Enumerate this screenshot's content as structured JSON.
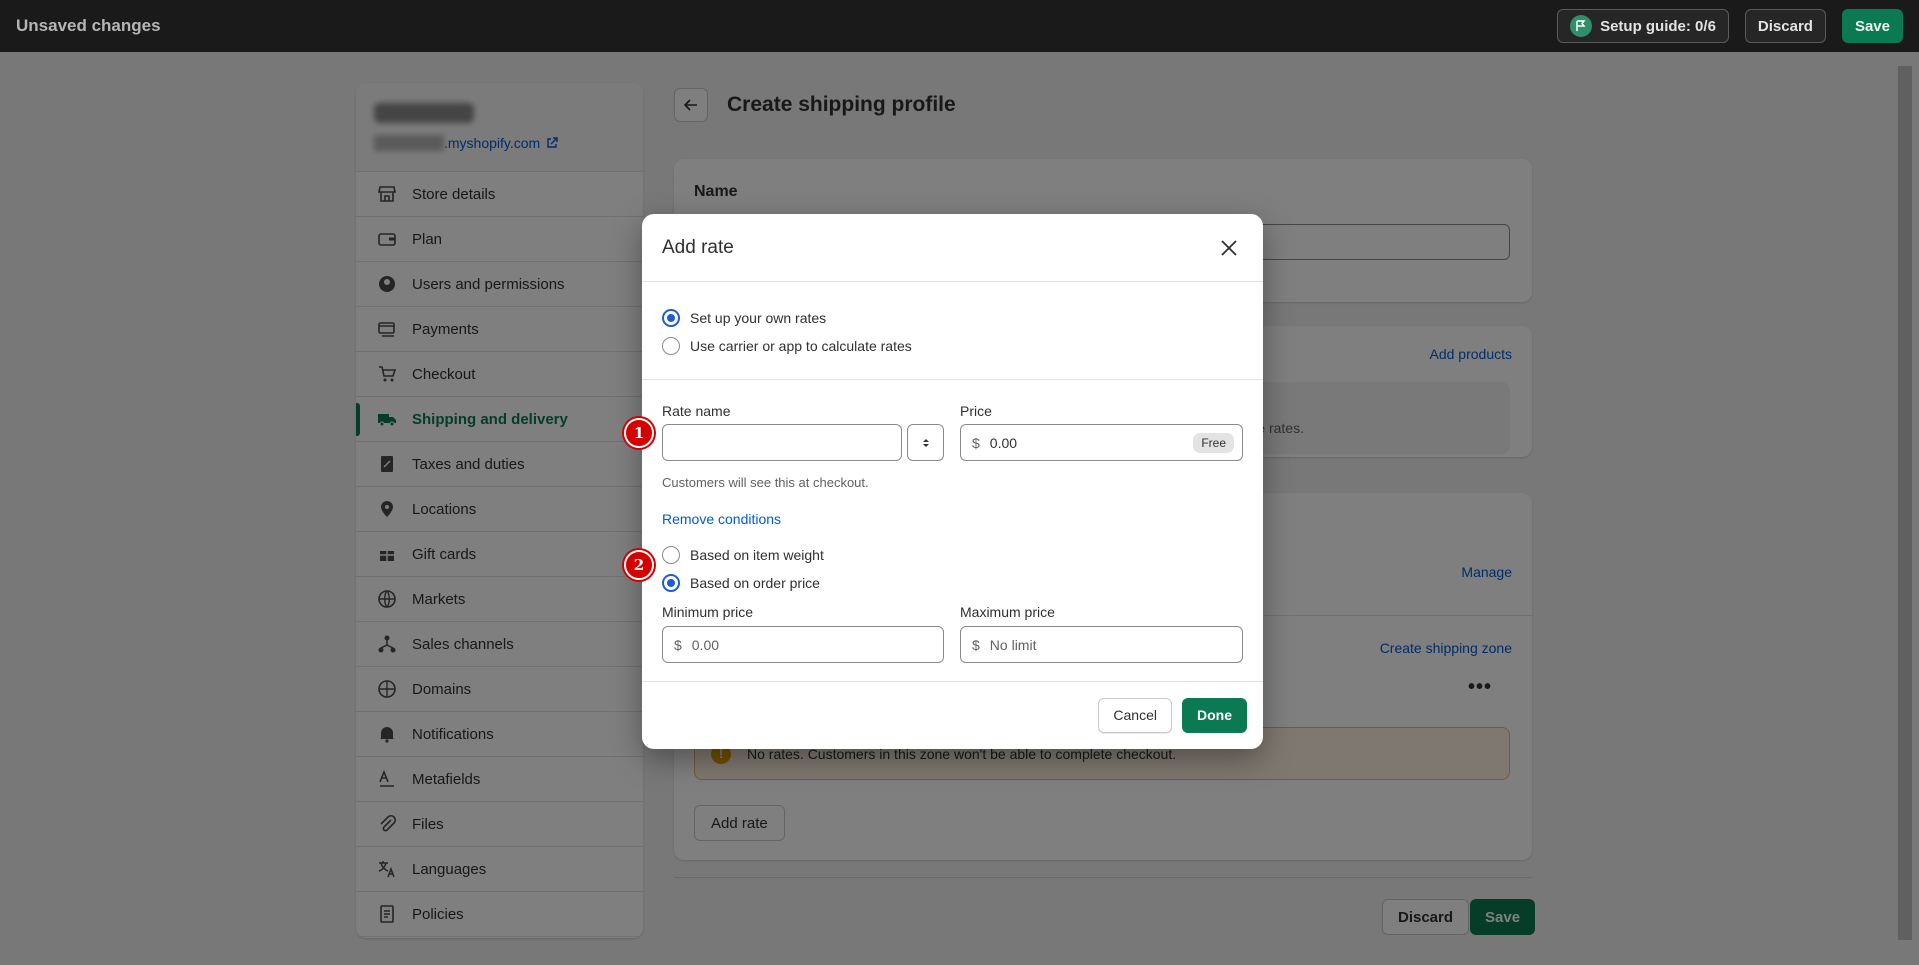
{
  "topbar": {
    "title": "Unsaved changes",
    "setup_guide_label": "Setup guide: 0/6",
    "discard_label": "Discard",
    "save_label": "Save"
  },
  "sidebar": {
    "store_url_suffix": ".myshopify.com",
    "items": [
      {
        "label": "Store details",
        "icon": "store-icon"
      },
      {
        "label": "Plan",
        "icon": "plan-icon"
      },
      {
        "label": "Users and permissions",
        "icon": "user-icon"
      },
      {
        "label": "Payments",
        "icon": "payments-icon"
      },
      {
        "label": "Checkout",
        "icon": "cart-icon"
      },
      {
        "label": "Shipping and delivery",
        "icon": "truck-icon",
        "active": true
      },
      {
        "label": "Taxes and duties",
        "icon": "tax-icon"
      },
      {
        "label": "Locations",
        "icon": "location-icon"
      },
      {
        "label": "Gift cards",
        "icon": "gift-icon"
      },
      {
        "label": "Markets",
        "icon": "globe-icon"
      },
      {
        "label": "Sales channels",
        "icon": "channels-icon"
      },
      {
        "label": "Domains",
        "icon": "domain-icon"
      },
      {
        "label": "Notifications",
        "icon": "bell-icon"
      },
      {
        "label": "Metafields",
        "icon": "metafields-icon"
      },
      {
        "label": "Files",
        "icon": "paperclip-icon"
      },
      {
        "label": "Languages",
        "icon": "language-icon"
      },
      {
        "label": "Policies",
        "icon": "policy-icon"
      }
    ]
  },
  "page": {
    "title": "Create shipping profile",
    "name_card_label": "Name",
    "add_products_link": "Add products",
    "rates_fragment": "e rates.",
    "manage_link": "Manage",
    "create_zone_link": "Create shipping zone",
    "warning_text": "No rates. Customers in this zone won't be able to complete checkout.",
    "add_rate_button": "Add rate",
    "discard_button": "Discard",
    "save_button": "Save"
  },
  "modal": {
    "title": "Add rate",
    "rate_type_options": [
      {
        "label": "Set up your own rates",
        "selected": true
      },
      {
        "label": "Use carrier or app to calculate rates",
        "selected": false
      }
    ],
    "rate_name_label": "Rate name",
    "rate_name_value": "",
    "rate_name_help": "Customers will see this at checkout.",
    "price_label": "Price",
    "price_currency": "$",
    "price_value": "0.00",
    "price_badge": "Free",
    "remove_conditions_link": "Remove conditions",
    "condition_options": [
      {
        "label": "Based on item weight",
        "selected": false
      },
      {
        "label": "Based on order price",
        "selected": true
      }
    ],
    "min_price_label": "Minimum price",
    "min_price_currency": "$",
    "min_price_placeholder": "0.00",
    "max_price_label": "Maximum price",
    "max_price_currency": "$",
    "max_price_placeholder": "No limit",
    "cancel_label": "Cancel",
    "done_label": "Done"
  },
  "markers": [
    "1",
    "2"
  ],
  "colors": {
    "brand_green": "#0b7a53",
    "link_blue": "#005bd3",
    "marker_red": "#d40000",
    "radio_blue": "#1f5bd1"
  }
}
